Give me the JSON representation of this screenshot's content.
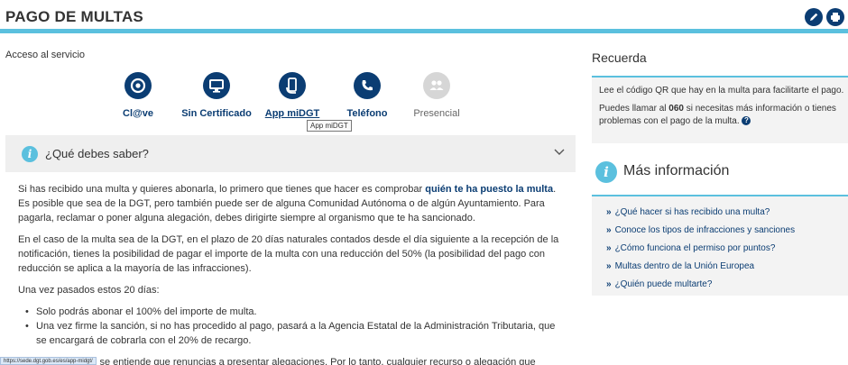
{
  "header": {
    "title": "PAGO DE MULTAS"
  },
  "acceso": {
    "label": "Acceso al servicio",
    "services": [
      {
        "label": "Cl@ve",
        "icon": "at-icon",
        "state": "normal"
      },
      {
        "label": "Sin Certificado",
        "icon": "monitor-icon",
        "state": "normal"
      },
      {
        "label": "App miDGT",
        "icon": "phone-hand-icon",
        "state": "active"
      },
      {
        "label": "Teléfono",
        "icon": "phone-icon",
        "state": "normal"
      },
      {
        "label": "Presencial",
        "icon": "people-icon",
        "state": "disabled"
      }
    ],
    "tooltip": "App miDGT"
  },
  "accordion": {
    "title": "¿Qué debes saber?"
  },
  "content": {
    "p1_before": "Si has recibido una multa y quieres abonarla, lo primero que tienes que hacer es comprobar ",
    "p1_link": "quién te ha puesto la multa",
    "p1_after": ". Es posible que sea de la DGT, pero también puede ser de alguna Comunidad Autónoma o de algún Ayuntamiento. Para pagarla, reclamar o poner alguna alegación, debes dirigirte siempre al organismo que te ha sancionado.",
    "p2": "En el caso de la multa sea de la DGT, en el plazo de 20 días naturales contados desde el día siguiente a la recepción de la notificación, tienes la posibilidad de pagar el importe de la multa con una reducción del 50% (la posibilidad del pago con reducción se aplica a la mayoría de las infracciones).",
    "p3": "Una vez pasados estos 20 días:",
    "bullets": [
      "Solo podrás abonar el 100% del importe de multa.",
      "Una vez firme la sanción, si no has procedido al pago, pasará a la Agencia Estatal de la Administración Tributaria, que se encargará de cobrarla con el 20% de recargo."
    ],
    "p4": "Si pagas la multa, se entiende que renuncias a presentar alegaciones. Por lo tanto, cualquier recurso o alegación que"
  },
  "status_url": "https://sede.dgt.gob.es/es/app-midgt/",
  "recuerda": {
    "title": "Recuerda",
    "line1": "Lee el código QR que hay en la multa para facilitarte el pago.",
    "line2_before": "Puedes llamar al ",
    "line2_bold": "060",
    "line2_after": " si necesitas más información o tienes",
    "line3": "problemas con el pago de la multa."
  },
  "mas_info": {
    "title": "Más información",
    "links": [
      "¿Qué hacer si has recibido una multa?",
      "Conoce los tipos de infracciones y sanciones",
      "¿Cómo funciona el permiso por puntos?",
      "Multas dentro de la Unión Europea",
      "¿Quién puede multarte?"
    ]
  },
  "colors": {
    "navy": "#0b3d73",
    "accent": "#5bc0de",
    "panel": "#f3f3f3"
  }
}
